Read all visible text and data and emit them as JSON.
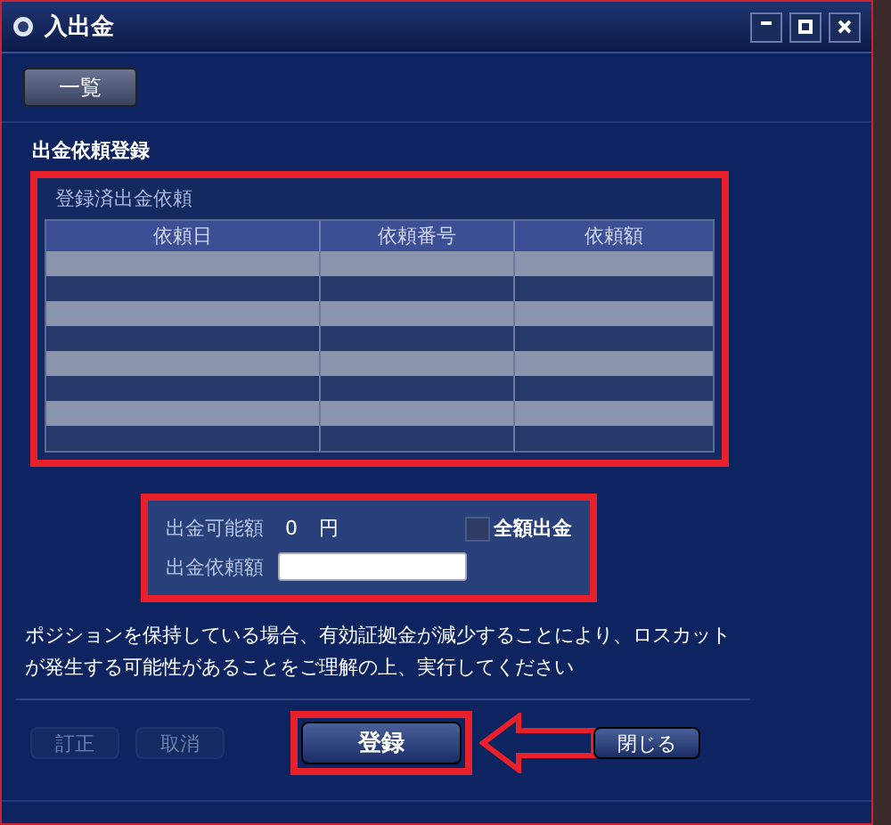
{
  "window": {
    "title": "入出金"
  },
  "toolbar": {
    "list_button": "一覧"
  },
  "section_title": "出金依頼登録",
  "registered": {
    "title": "登録済出金依頼",
    "annotated": true,
    "columns": [
      "依頼日",
      "依頼番号",
      "依頼額"
    ]
  },
  "amount_panel": {
    "annotated": true,
    "available_label": "出金可能額",
    "available_value": "0",
    "unit": "円",
    "full_withdrawal": {
      "label": "全額出金",
      "checked": false
    },
    "request_label": "出金依頼額"
  },
  "notice": "ポジションを保持している場合、有効証拠金が減少することにより、ロスカットが発生する可能性があることをご理解の上、実行してください",
  "buttons": [
    {
      "label": "訂正",
      "kind": "small",
      "disabled": true
    },
    {
      "label": "取消",
      "kind": "small",
      "disabled": true
    },
    {
      "label": "登録",
      "kind": "main",
      "disabled": false,
      "annotated": true
    },
    {
      "label": "閉じる",
      "kind": "small",
      "disabled": false
    }
  ]
}
